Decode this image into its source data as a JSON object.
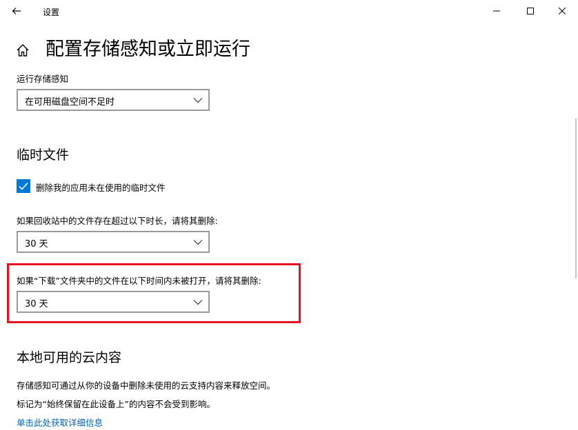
{
  "window": {
    "title": "设置"
  },
  "page": {
    "title": "配置存储感知或立即运行"
  },
  "run_storage_sense": {
    "label": "运行存储感知",
    "selected": "在可用磁盘空间不足时"
  },
  "temp_files": {
    "heading": "临时文件",
    "delete_temp_checkbox": {
      "label": "删除我的应用未在使用的临时文件",
      "checked": true
    },
    "recycle_bin": {
      "label": "如果回收站中的文件存在超过以下时长，请将其删除:",
      "selected": "30 天"
    },
    "downloads": {
      "label": "如果“下载”文件夹中的文件在以下时间内未被打开，请将其删除:",
      "selected": "30 天"
    }
  },
  "cloud": {
    "heading": "本地可用的云内容",
    "desc1": "存储感知可通过从你的设备中删除未使用的云支持内容来释放空间。",
    "desc2": "标记为“始终保留在此设备上”的内容不会受到影响。",
    "link": "单击此处获取详细信息"
  },
  "colors": {
    "accent": "#0078d7",
    "highlight_border": "#e81123",
    "link": "#0066b4"
  },
  "icons": {
    "back": "back-arrow-icon",
    "home": "home-icon",
    "minimize": "minimize-icon",
    "maximize": "maximize-icon",
    "close": "close-icon",
    "chevron": "chevron-down-icon",
    "check": "checkmark-icon"
  }
}
